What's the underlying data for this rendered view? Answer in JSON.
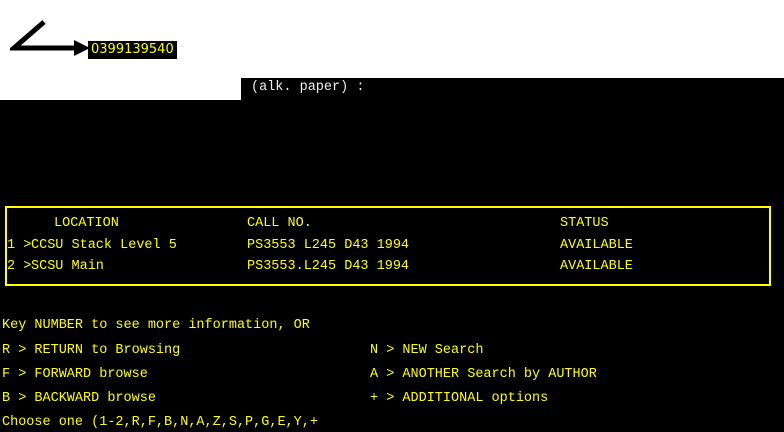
{
  "header": {
    "isbn_label": "0399139540",
    "paper_note": "(alk. paper) :"
  },
  "holdings": {
    "columns": {
      "location": "LOCATION",
      "call_no": "CALL NO.",
      "status": "STATUS"
    },
    "rows": [
      {
        "num": "1 >",
        "location": "CCSU Stack Level 5",
        "call_no": "PS3553 L245 D43 1994",
        "status": "AVAILABLE"
      },
      {
        "num": "2 >",
        "location": "SCSU Main",
        "call_no": "PS3553.L245 D43 1994",
        "status": "AVAILABLE"
      }
    ]
  },
  "menu": {
    "instruction": "Key NUMBER to see more information, OR",
    "options_left": [
      "R > RETURN to Browsing",
      "F > FORWARD browse",
      "B > BACKWARD browse"
    ],
    "options_right": [
      "N > NEW Search",
      "A > ANOTHER Search by AUTHOR",
      "+ > ADDITIONAL options"
    ],
    "prompt": "Choose one (1-2,R,F,B,N,A,Z,S,P,G,E,Y,+"
  },
  "colors": {
    "terminal_bg": "#000000",
    "text_yellow": "#ffff00",
    "text_white": "#f0f0f0"
  }
}
